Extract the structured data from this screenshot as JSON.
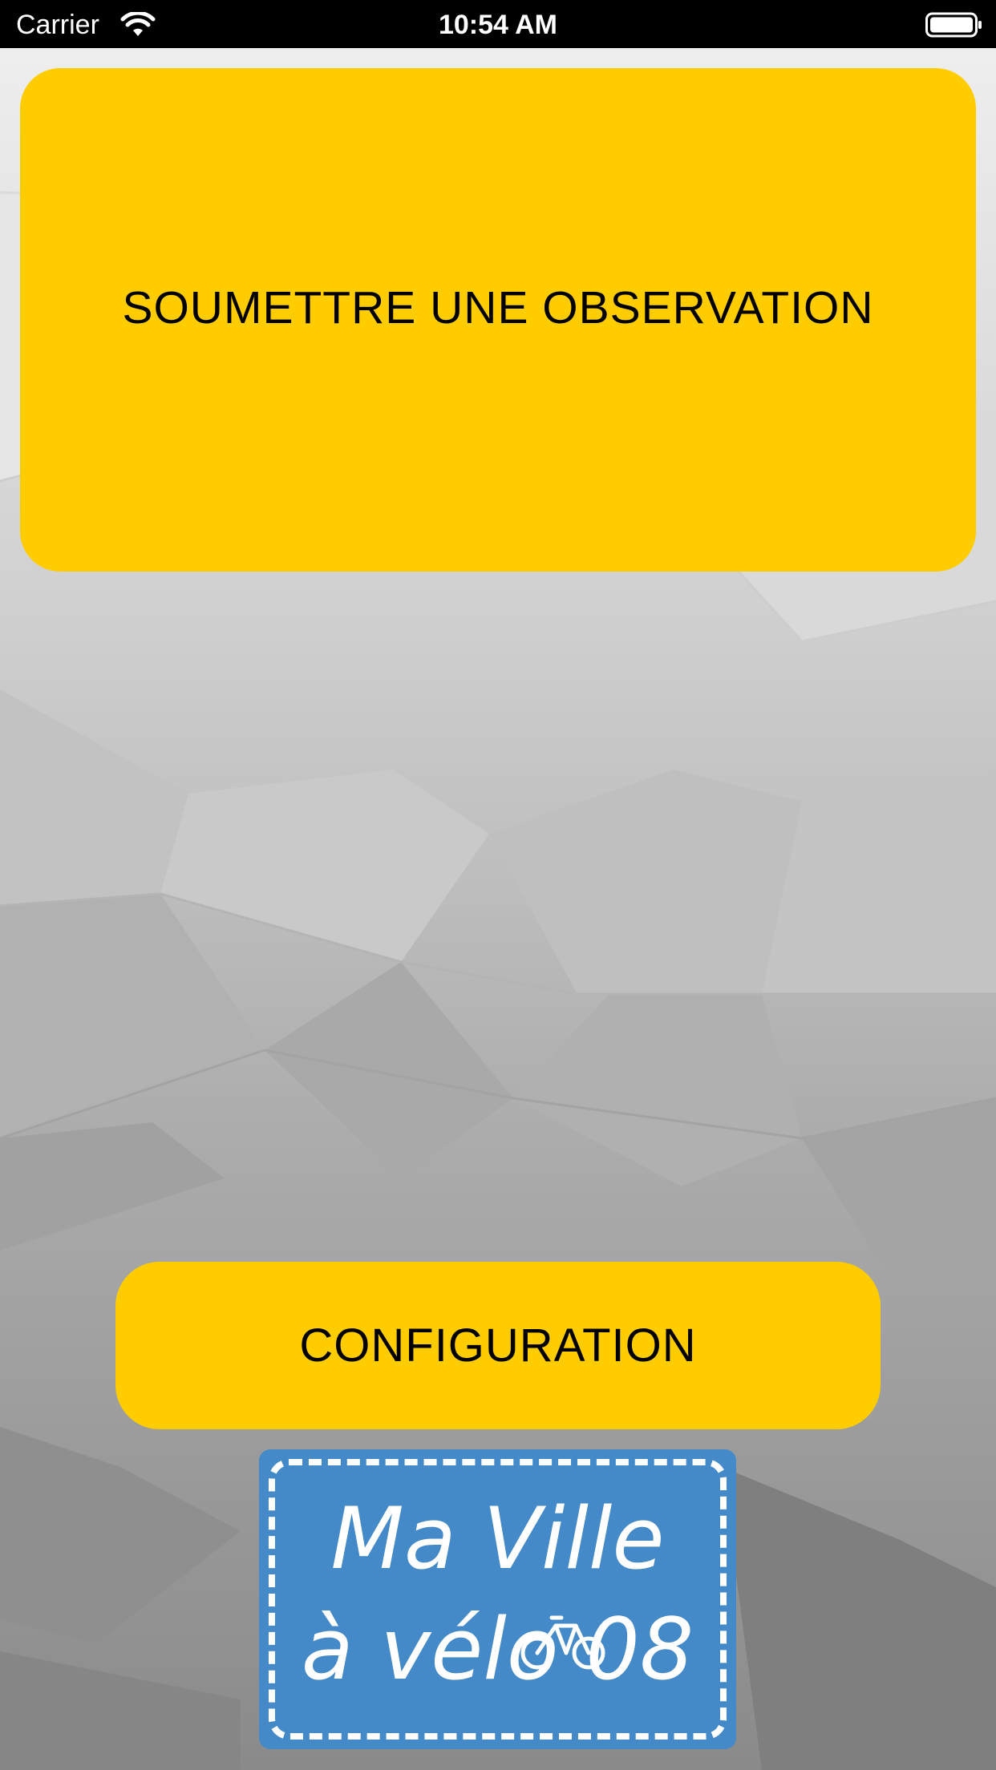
{
  "status_bar": {
    "carrier": "Carrier",
    "time": "10:54 AM",
    "wifi_icon": "wifi-icon",
    "battery_icon": "battery-icon"
  },
  "buttons": {
    "observation_label": "SOUMETTRE UNE OBSERVATION",
    "configuration_label": "CONFIGURATION"
  },
  "logo": {
    "line1": "Ma Ville",
    "line2": "à vélo 08",
    "background_color": "#4489c8"
  },
  "colors": {
    "accent": "#ffcc00",
    "status_bar": "#000000"
  }
}
